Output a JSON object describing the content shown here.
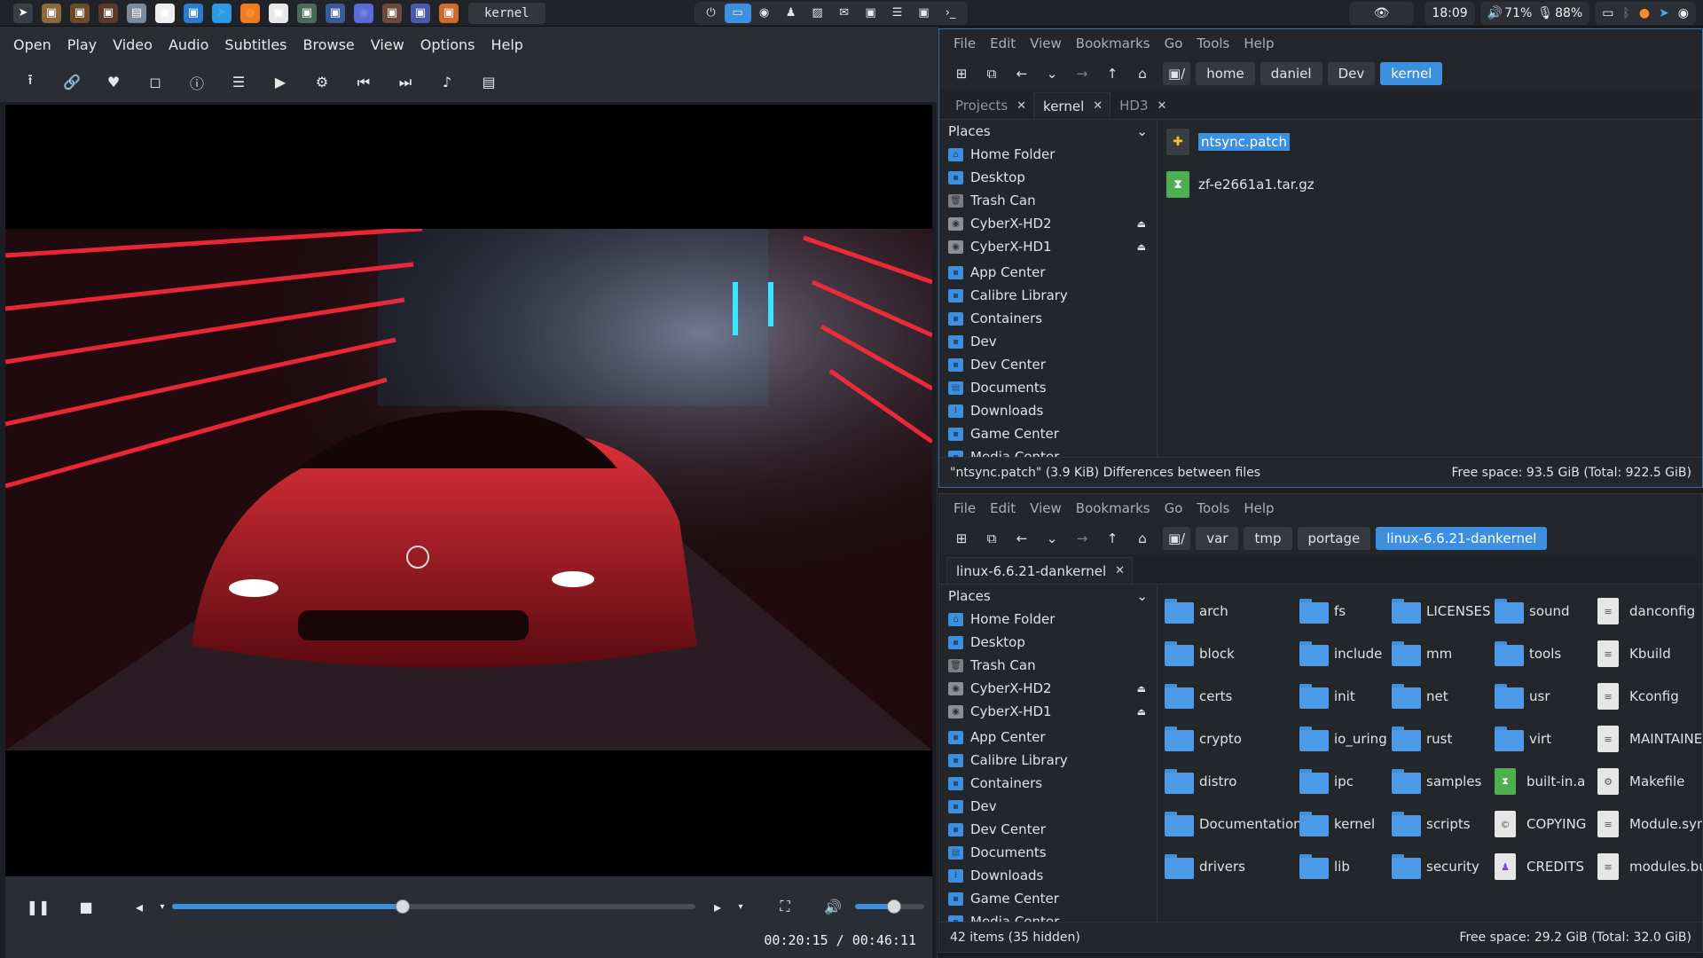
{
  "taskbar": {
    "active_window_label": "kernel",
    "clock": "18:09",
    "volume": "71%",
    "mic": "88%",
    "launcher_icons": [
      "launcher-icon",
      "app-icon",
      "app-icon",
      "app-icon",
      "files-icon",
      "app-icon",
      "app-icon",
      "telegram-icon",
      "firefox-icon",
      "app-icon",
      "app-icon",
      "app-icon",
      "discord-icon",
      "app-icon",
      "app-icon",
      "app-icon"
    ],
    "center_icons": [
      "power-icon",
      "folder-icon",
      "discord-icon",
      "user-icon",
      "image-icon",
      "mail-icon",
      "app-icon",
      "list-icon",
      "app-icon",
      "terminal-icon"
    ]
  },
  "player": {
    "menu": [
      "Open",
      "Play",
      "Video",
      "Audio",
      "Subtitles",
      "Browse",
      "View",
      "Options",
      "Help"
    ],
    "time": "00:20:15 / 00:46:11",
    "progress": 0.44,
    "volume_level": 0.56
  },
  "fm1": {
    "menu": [
      "File",
      "Edit",
      "View",
      "Bookmarks",
      "Go",
      "Tools",
      "Help"
    ],
    "breadcrumbs": [
      "home",
      "daniel",
      "Dev",
      "kernel"
    ],
    "tabs": [
      {
        "label": "Projects",
        "active": false
      },
      {
        "label": "kernel",
        "active": true
      },
      {
        "label": "HD3",
        "active": false
      }
    ],
    "places_label": "Places",
    "places": [
      "Home Folder",
      "Desktop",
      "Trash Can",
      "CyberX-HD2",
      "CyberX-HD1",
      "App Center",
      "Calibre Library",
      "Containers",
      "Dev",
      "Dev Center",
      "Documents",
      "Downloads",
      "Game Center",
      "Media Center"
    ],
    "files": [
      {
        "name": "ntsync.patch",
        "selected": true
      },
      {
        "name": "zf-e2661a1.tar.gz",
        "selected": false
      }
    ],
    "status_left": "\"ntsync.patch\" (3.9 KiB) Differences between files",
    "status_right": "Free space: 93.5 GiB (Total: 922.5 GiB)"
  },
  "fm2": {
    "menu": [
      "File",
      "Edit",
      "View",
      "Bookmarks",
      "Go",
      "Tools",
      "Help"
    ],
    "breadcrumbs": [
      "var",
      "tmp",
      "portage",
      "linux-6.6.21-dankernel"
    ],
    "tabs": [
      {
        "label": "linux-6.6.21-dankernel",
        "active": true
      }
    ],
    "places_label": "Places",
    "places": [
      "Home Folder",
      "Desktop",
      "Trash Can",
      "CyberX-HD2",
      "CyberX-HD1",
      "App Center",
      "Calibre Library",
      "Containers",
      "Dev",
      "Dev Center",
      "Documents",
      "Downloads",
      "Game Center",
      "Media Center"
    ],
    "columns": [
      [
        "arch",
        "block",
        "certs",
        "crypto",
        "distro",
        "Documentation",
        "drivers"
      ],
      [
        "fs",
        "include",
        "init",
        "io_uring",
        "ipc",
        "kernel",
        "lib"
      ],
      [
        "LICENSES",
        "mm",
        "net",
        "rust",
        "samples",
        "scripts",
        "security"
      ],
      [
        "sound",
        "tools",
        "usr",
        "virt",
        "built-in.a",
        "COPYING",
        "CREDITS"
      ],
      [
        "danconfig",
        "Kbuild",
        "Kconfig",
        "MAINTAINERS",
        "Makefile",
        "Module.symvers",
        "modules.builtin"
      ]
    ],
    "status_left": "42 items (35 hidden)",
    "status_right": "Free space: 29.2 GiB (Total: 32.0 GiB)"
  }
}
